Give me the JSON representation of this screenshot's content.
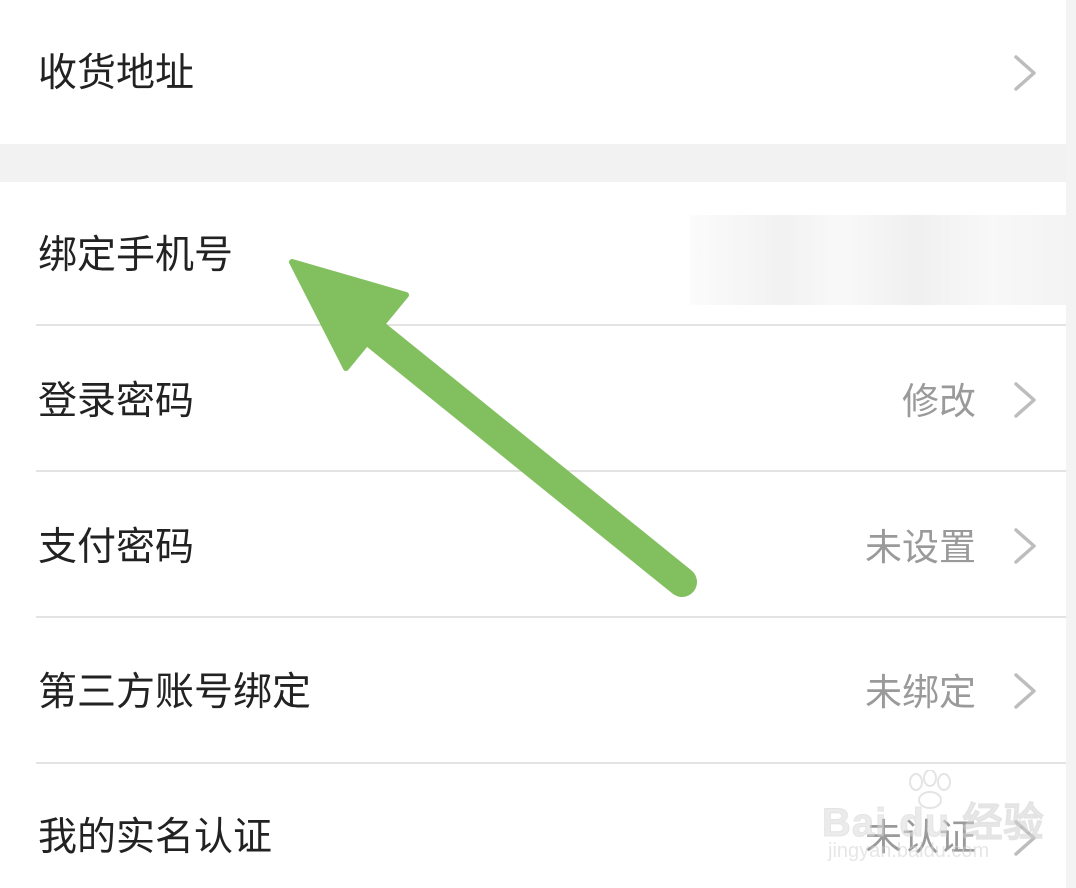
{
  "rows": [
    {
      "label": "收货地址",
      "value": "",
      "chevron": true
    },
    {
      "label": "绑定手机号",
      "value": "",
      "chevron": false
    },
    {
      "label": "登录密码",
      "value": "修改",
      "chevron": true
    },
    {
      "label": "支付密码",
      "value": "未设置",
      "chevron": true
    },
    {
      "label": "第三方账号绑定",
      "value": "未绑定",
      "chevron": true
    },
    {
      "label": "我的实名认证",
      "value": "未认证",
      "chevron": true
    }
  ],
  "annotation": {
    "arrow_color": "#82bf5f",
    "target": "绑定手机号"
  },
  "watermark": {
    "main": "Bai du 经验",
    "sub": "jingyan.baidu.com"
  },
  "icons": {
    "chevron": "chevron-right-icon",
    "arrow": "arrow-up-left-icon",
    "watermark_paw": "paw-icon"
  }
}
